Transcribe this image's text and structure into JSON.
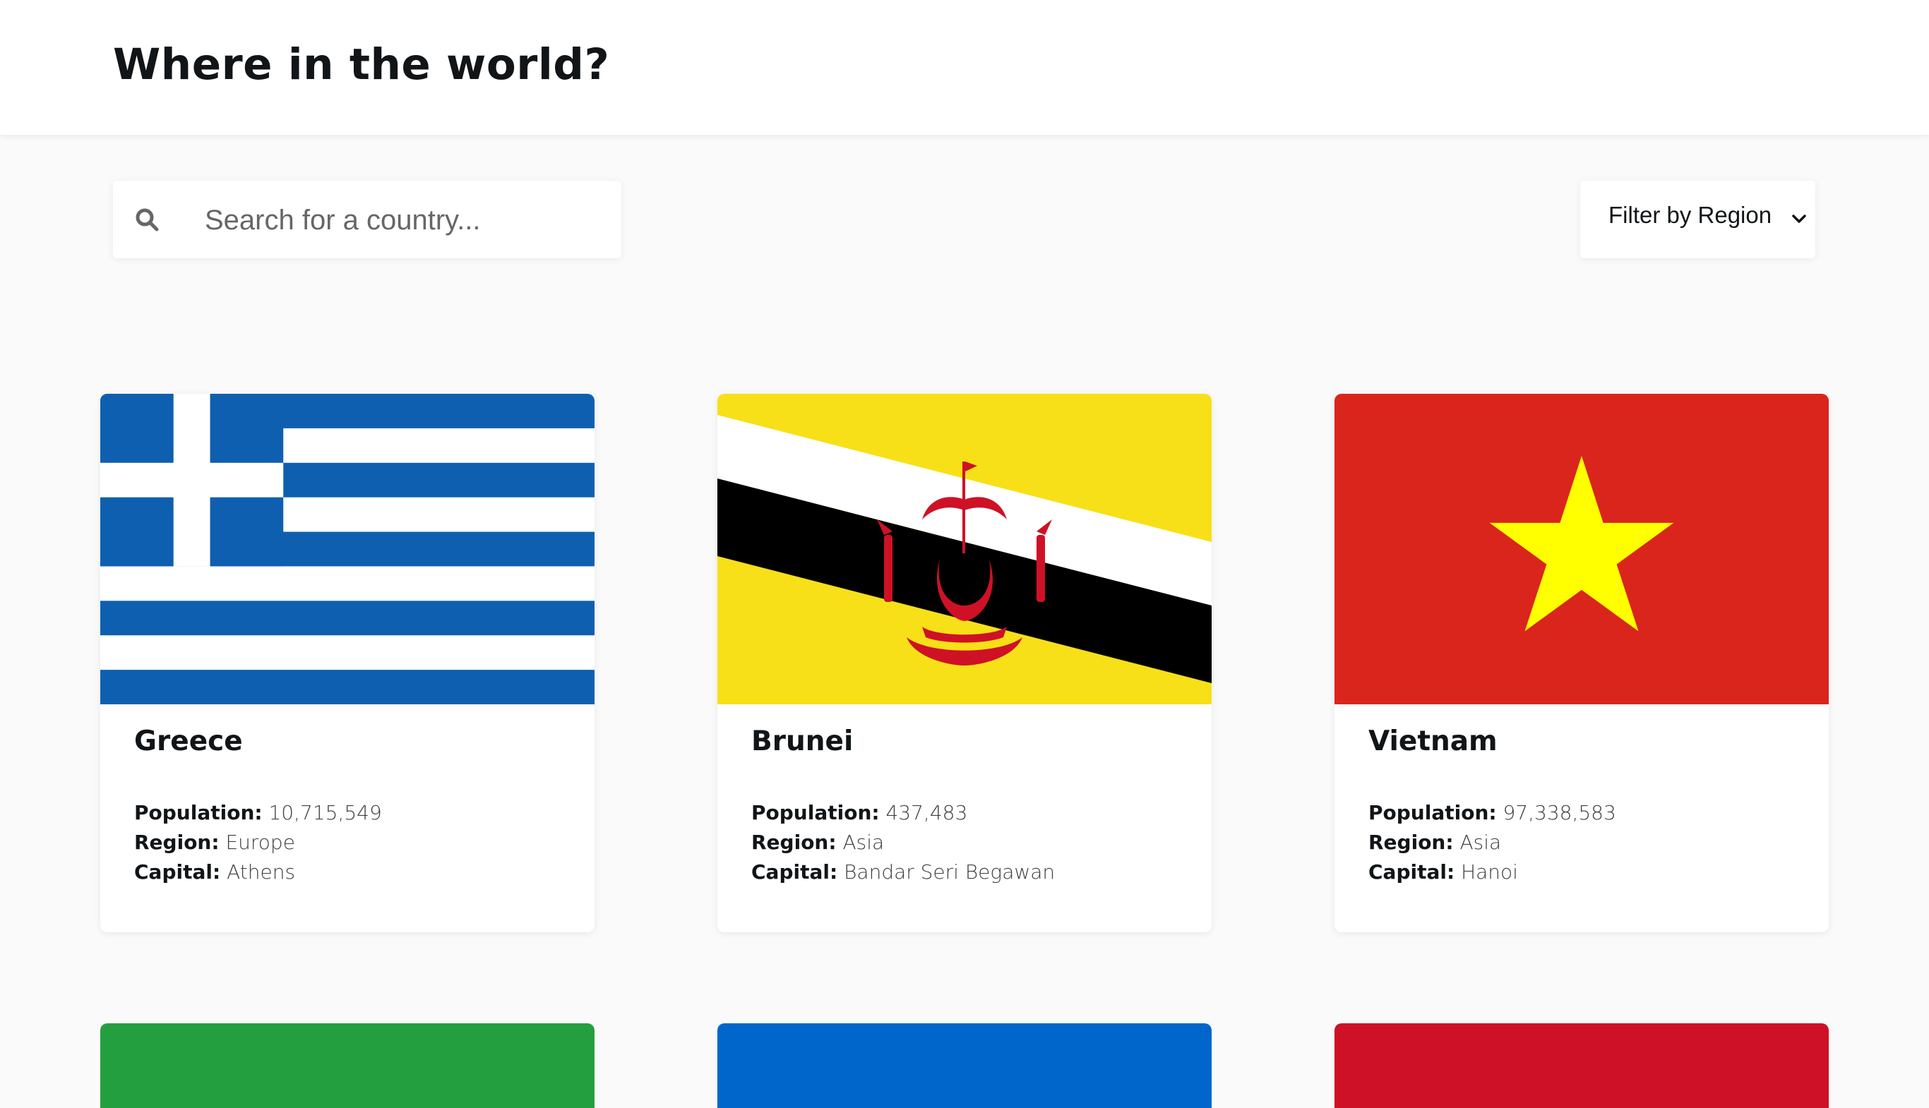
{
  "header": {
    "title": "Where in the world?"
  },
  "search": {
    "placeholder": "Search for a country..."
  },
  "filter": {
    "label": "Filter by Region"
  },
  "countries": [
    {
      "name": "Greece",
      "population_label": "Population:",
      "population": "10,715,549",
      "region_label": "Region:",
      "region": "Europe",
      "capital_label": "Capital:",
      "capital": "Athens"
    },
    {
      "name": "Brunei",
      "population_label": "Population:",
      "population": "437,483",
      "region_label": "Region:",
      "region": "Asia",
      "capital_label": "Capital:",
      "capital": "Bandar Seri Begawan"
    },
    {
      "name": "Vietnam",
      "population_label": "Population:",
      "population": "97,338,583",
      "region_label": "Region:",
      "region": "Asia",
      "capital_label": "Capital:",
      "capital": "Hanoi"
    }
  ],
  "colors": {
    "background": "#fafafa",
    "greece_blue": "#0f5fb0",
    "brunei_yellow": "#f7e017",
    "brunei_red": "#cf1126",
    "vietnam_red": "#da251d",
    "vietnam_star": "#ffff00",
    "stub_green": "#239f40",
    "stub_blue": "#0066cc",
    "stub_red": "#ce1126"
  }
}
